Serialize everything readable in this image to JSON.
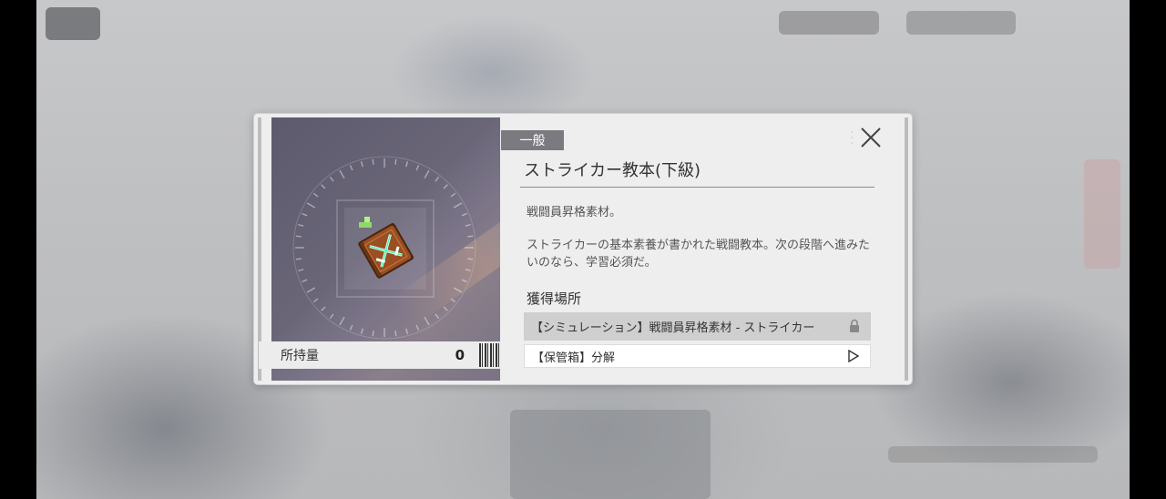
{
  "item": {
    "rarity": "一般",
    "name": "ストライカー教本(下級)",
    "description_short": "戦闘員昇格素材。",
    "description_long": "ストライカーの基本素養が書かれた戦闘教本。次の段階へ進みたいのなら、学習必須だ。",
    "icon": "book-with-crossed-swords-icon"
  },
  "quantity": {
    "label": "所持量",
    "value": "0"
  },
  "sources": {
    "title": "獲得場所",
    "items": [
      {
        "label": "【シミュレーション】戦闘員昇格素材 - ストライカー",
        "icon": "lock-icon",
        "locked": true
      },
      {
        "label": "【保管箱】分解",
        "icon": "play-arrow-icon",
        "locked": false
      }
    ]
  },
  "colors": {
    "rarity_tag": "#7a7a80",
    "panel": "#eeeeee",
    "item_background": "#64607a"
  }
}
